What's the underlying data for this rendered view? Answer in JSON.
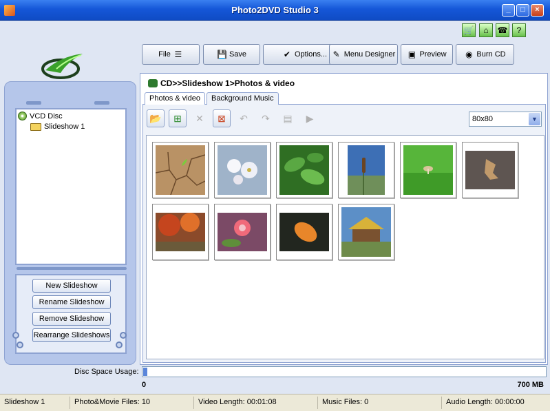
{
  "window": {
    "title": "Photo2DVD Studio 3"
  },
  "toolbar": {
    "file_label": "File",
    "save_label": "Save",
    "options_label": "Options...",
    "menu_designer_label": "Menu Designer",
    "preview_label": "Preview",
    "burn_label": "Burn CD"
  },
  "tree": {
    "disc_label": "VCD Disc",
    "slideshow_label": "Slideshow 1"
  },
  "left_buttons": {
    "new": "New Slideshow",
    "rename": "Rename Slideshow",
    "remove": "Remove Slideshow",
    "rearrange": "Rearrange Slideshows"
  },
  "breadcrumb": "CD>>Slideshow 1>Photos & video",
  "tabs": {
    "photos": "Photos & video",
    "music": "Background Music"
  },
  "thumb_size": {
    "selected": "80x80"
  },
  "photos": [
    {
      "subject": "dry cracked earth with sprout"
    },
    {
      "subject": "white blossoms"
    },
    {
      "subject": "green leaves"
    },
    {
      "subject": "cattails against sky"
    },
    {
      "subject": "mushroom on grass"
    },
    {
      "subject": "dry leaf on gravel"
    },
    {
      "subject": "autumn trees"
    },
    {
      "subject": "pink flower"
    },
    {
      "subject": "orange leaf on dark"
    },
    {
      "subject": "wooden hut"
    }
  ],
  "disc": {
    "label": "Disc Space Usage:",
    "min": "0",
    "max": "700 MB",
    "used_fraction": 0.01
  },
  "status": {
    "slideshow": "Slideshow 1",
    "files": "Photo&Movie Files: 10",
    "video_length": "Video Length: 00:01:08",
    "music_files": "Music Files: 0",
    "audio_length": "Audio Length: 00:00:00"
  },
  "colors": {
    "title_bar": "#1557d8",
    "accent": "#5a86da",
    "panel": "#b5c6ea"
  }
}
